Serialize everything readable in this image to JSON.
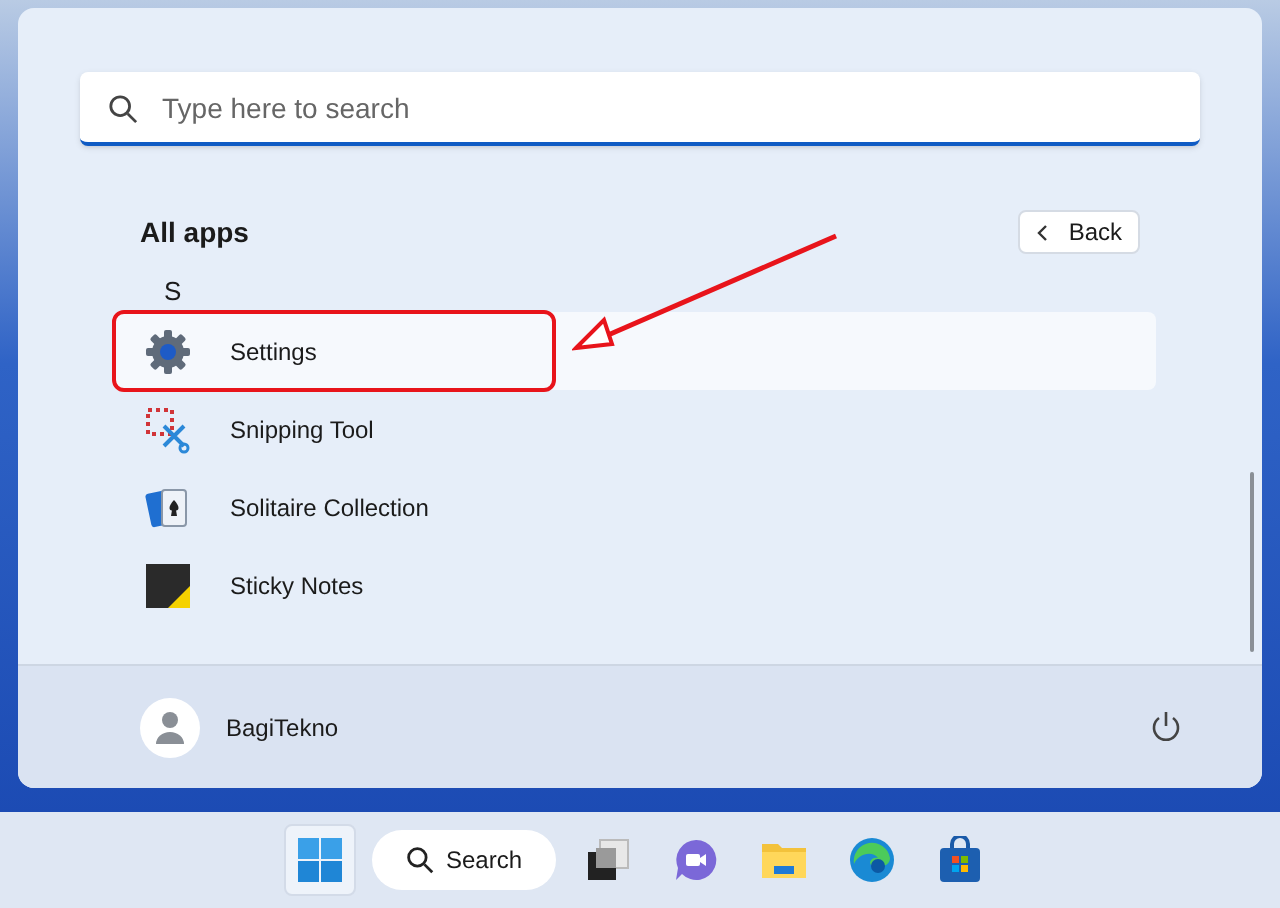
{
  "search": {
    "placeholder": "Type here to search"
  },
  "section_title": "All apps",
  "back_button": {
    "label": "Back"
  },
  "letter": "S",
  "apps": [
    {
      "kind": "settings",
      "name": "Settings",
      "selected": true,
      "annotated": true
    },
    {
      "kind": "snipping",
      "name": "Snipping Tool",
      "selected": false,
      "annotated": false
    },
    {
      "kind": "solitaire",
      "name": "Solitaire Collection",
      "selected": false,
      "annotated": false
    },
    {
      "kind": "sticky",
      "name": "Sticky Notes",
      "selected": false,
      "annotated": false
    }
  ],
  "user": {
    "name": "BagiTekno"
  },
  "taskbar": [
    {
      "kind": "start",
      "selected": true
    },
    {
      "kind": "search",
      "label": "Search",
      "selected": false
    },
    {
      "kind": "taskview",
      "selected": false
    },
    {
      "kind": "chat",
      "selected": false
    },
    {
      "kind": "explorer",
      "selected": false
    },
    {
      "kind": "edge",
      "selected": false
    },
    {
      "kind": "store",
      "selected": false
    }
  ]
}
